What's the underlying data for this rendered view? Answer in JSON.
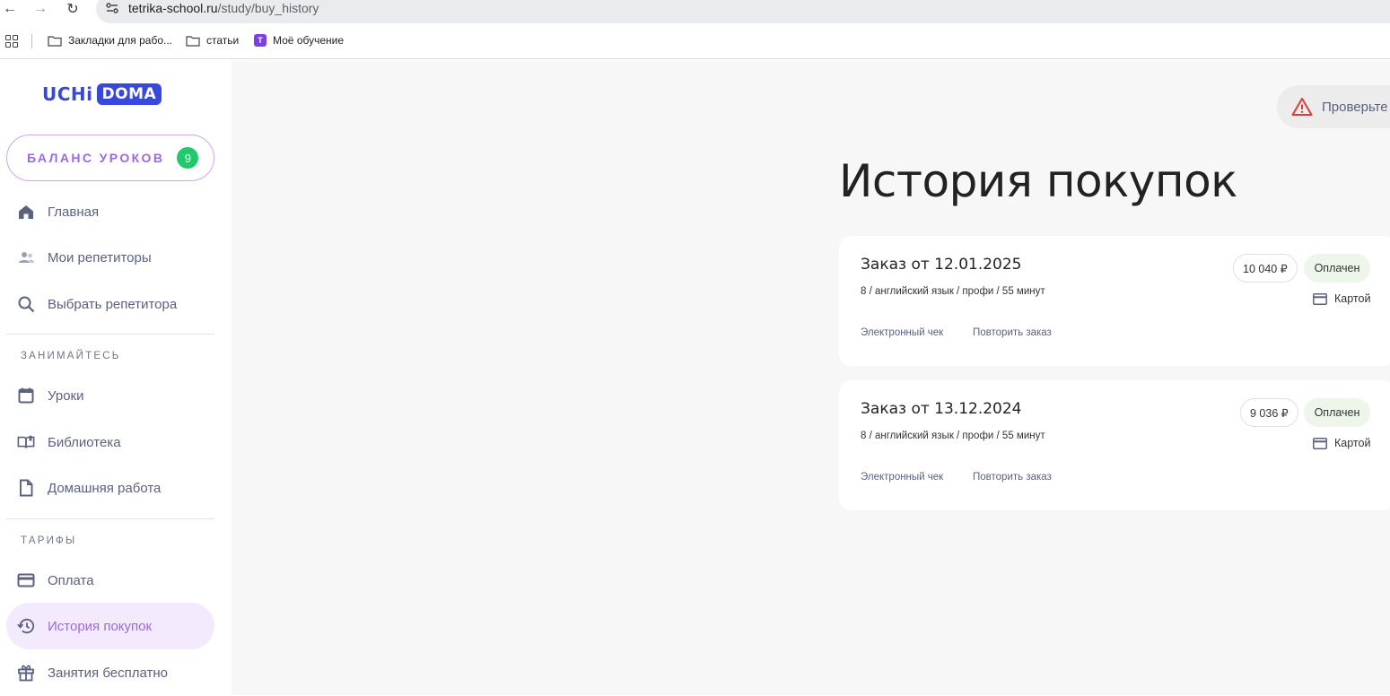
{
  "browser": {
    "url_host": "tetrika-school.ru",
    "url_path": "/study/buy_history",
    "bookmarks": [
      {
        "label": "Закладки для рабо...",
        "icon": "folder-icon"
      },
      {
        "label": "статьи",
        "icon": "folder-icon"
      },
      {
        "label": "Моё обучение",
        "icon": "tetrika-icon"
      }
    ]
  },
  "sidebar": {
    "logo_left": "UCHi",
    "logo_right": "DOMA",
    "balance_label": "БАЛАНС УРОКОВ",
    "balance_count": "9",
    "items_top": [
      {
        "label": "Главная",
        "icon": "home-icon"
      },
      {
        "label": "Мои репетиторы",
        "icon": "users-icon"
      },
      {
        "label": "Выбрать репетитора",
        "icon": "search-icon"
      }
    ],
    "section_study": "ЗАНИМАЙТЕСЬ",
    "items_study": [
      {
        "label": "Уроки",
        "icon": "calendar-icon"
      },
      {
        "label": "Библиотека",
        "icon": "book-icon"
      },
      {
        "label": "Домашняя работа",
        "icon": "document-icon"
      }
    ],
    "section_tariffs": "ТАРИФЫ",
    "items_tariffs": [
      {
        "label": "Оплата",
        "icon": "card-icon"
      },
      {
        "label": "История покупок",
        "icon": "history-icon",
        "active": true
      },
      {
        "label": "Занятия бесплатно",
        "icon": "gift-icon"
      }
    ]
  },
  "main": {
    "alert_text": "Проверьте",
    "title": "История покупок",
    "orders": [
      {
        "title": "Заказ от 12.01.2025",
        "description": "8 / английский язык / профи / 55 минут",
        "price": "10 040 ₽",
        "status": "Оплачен",
        "payment_method": "Картой",
        "receipt_link": "Электронный чек",
        "repeat_link": "Повторить заказ"
      },
      {
        "title": "Заказ от 13.12.2024",
        "description": "8 / английский язык / профи / 55 минут",
        "price": "9 036 ₽",
        "status": "Оплачен",
        "payment_method": "Картой",
        "receipt_link": "Электронный чек",
        "repeat_link": "Повторить заказ"
      }
    ]
  },
  "colors": {
    "accent_purple": "#9b6ae0",
    "brand_blue": "#3848d8",
    "badge_green": "#20c96b",
    "status_bg": "#eef6ec"
  }
}
